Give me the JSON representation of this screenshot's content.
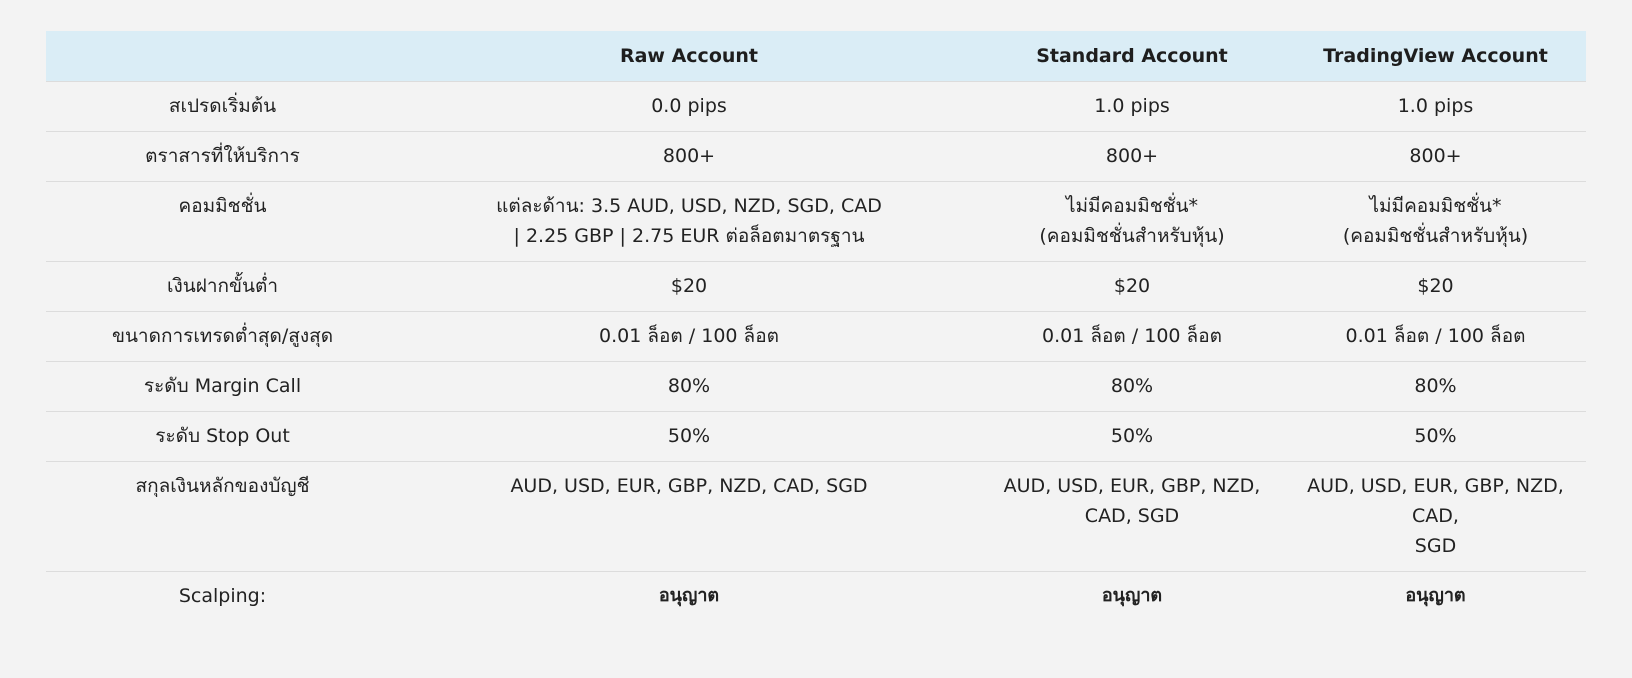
{
  "table": {
    "headers": [
      "",
      "Raw Account",
      "Standard Account",
      "TradingView Account"
    ],
    "rows": [
      {
        "label": "สเปรดเริ่มต้น",
        "raw": [
          "0.0 pips"
        ],
        "standard": [
          "1.0 pips"
        ],
        "tradingview": [
          "1.0 pips"
        ]
      },
      {
        "label": "ตราสารที่ให้บริการ",
        "raw": [
          "800+"
        ],
        "standard": [
          "800+"
        ],
        "tradingview": [
          "800+"
        ]
      },
      {
        "label": "คอมมิชชั่น",
        "raw": [
          "แต่ละด้าน: 3.5 AUD, USD, NZD, SGD, CAD",
          "| 2.25 GBP | 2.75 EUR ต่อล็อตมาตรฐาน"
        ],
        "standard": [
          "ไม่มีคอมมิชชั่น*",
          "(คอมมิชชั่นสำหรับหุ้น)"
        ],
        "tradingview": [
          "ไม่มีคอมมิชชั่น*",
          "(คอมมิชชั่นสำหรับหุ้น)"
        ]
      },
      {
        "label": "เงินฝากขั้นต่ำ",
        "raw": [
          "$20"
        ],
        "standard": [
          "$20"
        ],
        "tradingview": [
          "$20"
        ]
      },
      {
        "label": "ขนาดการเทรดต่ำสุด/สูงสุด",
        "raw": [
          "0.01 ล็อต / 100 ล็อต"
        ],
        "standard": [
          "0.01 ล็อต / 100 ล็อต"
        ],
        "tradingview": [
          "0.01 ล็อต / 100 ล็อต"
        ]
      },
      {
        "label": "ระดับ Margin Call",
        "raw": [
          "80%"
        ],
        "standard": [
          "80%"
        ],
        "tradingview": [
          "80%"
        ]
      },
      {
        "label": "ระดับ Stop Out",
        "raw": [
          "50%"
        ],
        "standard": [
          "50%"
        ],
        "tradingview": [
          "50%"
        ]
      },
      {
        "label": "สกุลเงินหลักของบัญชี",
        "raw": [
          "AUD, USD, EUR, GBP, NZD, CAD, SGD"
        ],
        "standard": [
          "AUD, USD, EUR, GBP, NZD,",
          "CAD, SGD"
        ],
        "tradingview": [
          "AUD, USD, EUR, GBP, NZD, CAD,",
          "SGD"
        ]
      },
      {
        "label": "Scalping:",
        "raw": [
          "อนุญาต"
        ],
        "standard": [
          "อนุญาต"
        ],
        "tradingview": [
          "อนุญาต"
        ]
      }
    ]
  }
}
